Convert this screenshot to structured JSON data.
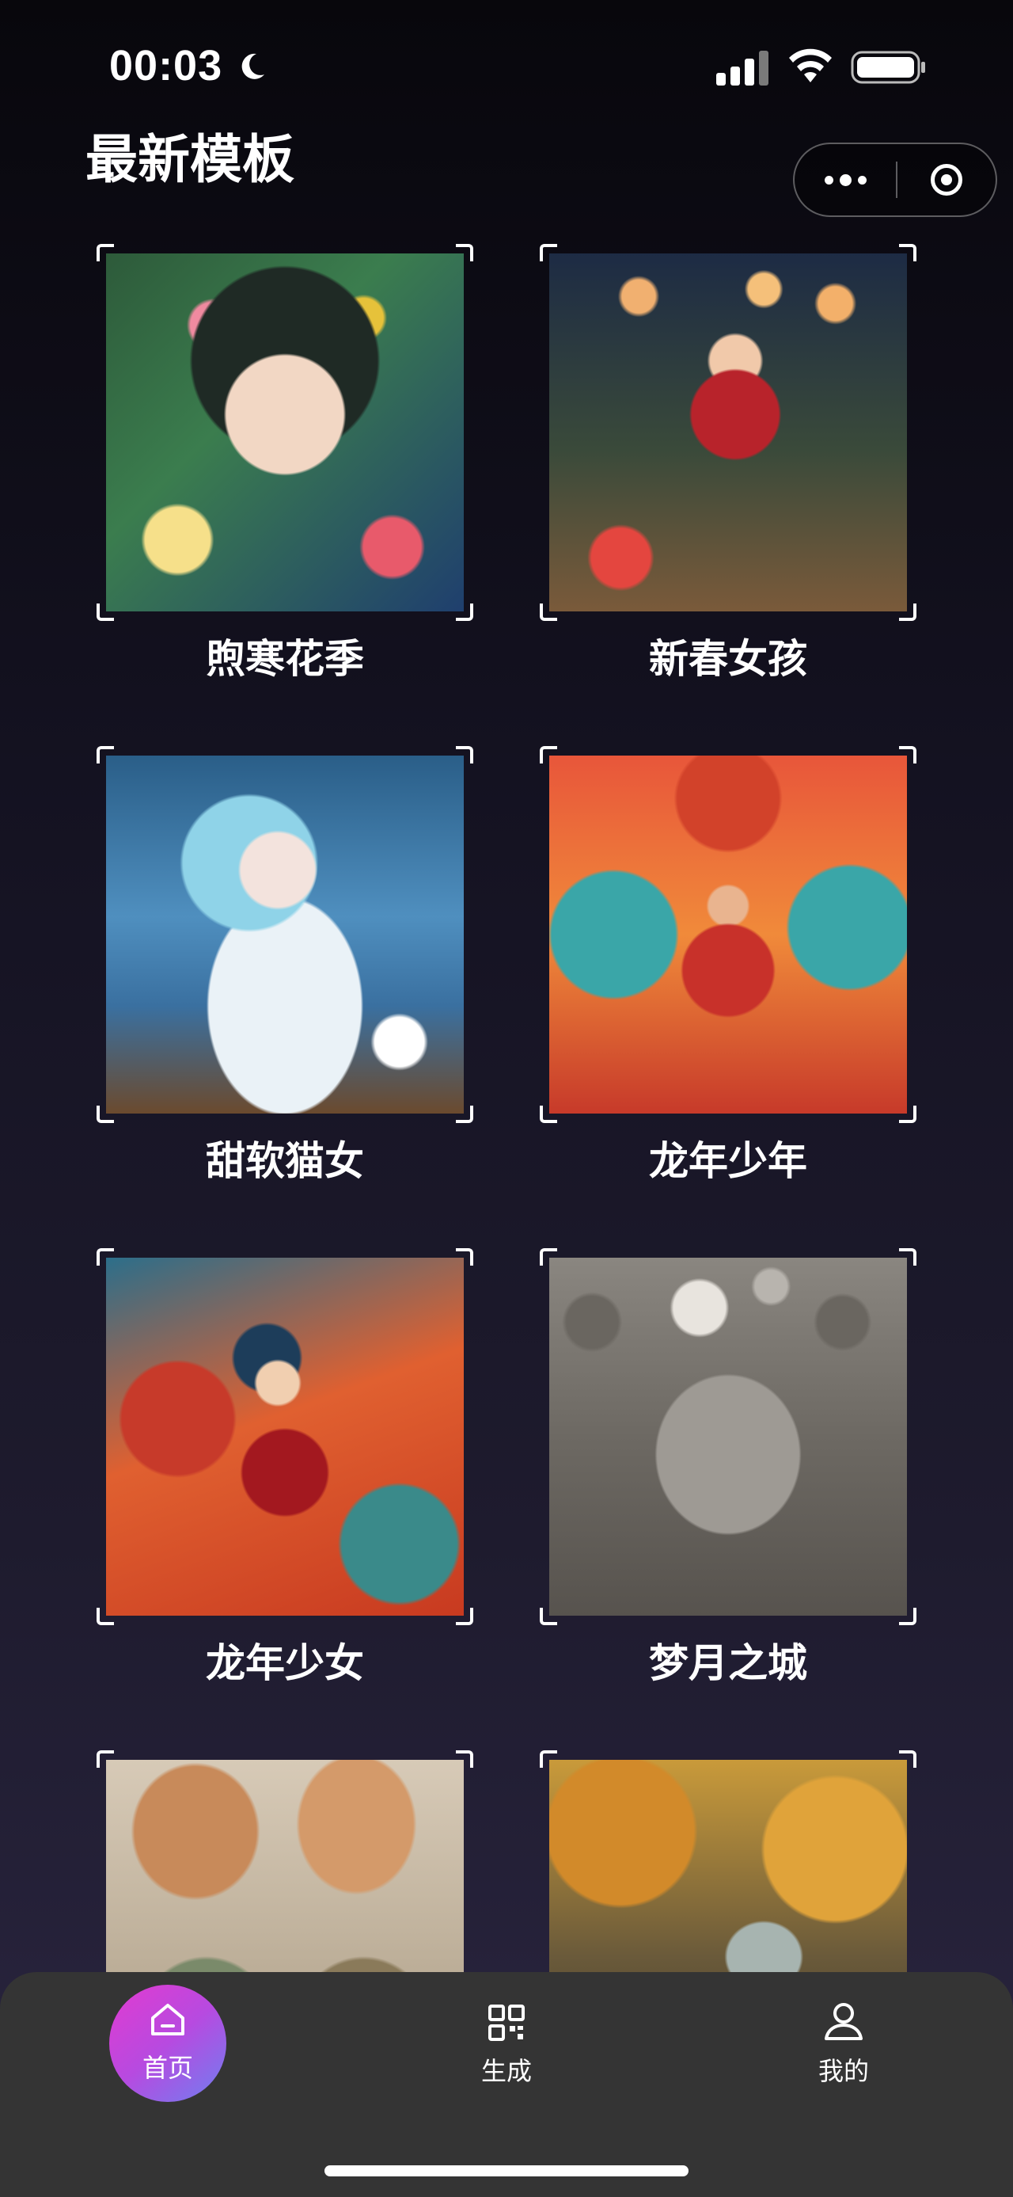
{
  "status_bar": {
    "time": "00:03",
    "icons": [
      "moon-icon",
      "signal-icon",
      "wifi-icon",
      "battery-icon"
    ]
  },
  "header": {
    "title": "最新模板",
    "capsule": {
      "more_icon": "more-dots-icon",
      "close_icon": "target-ring-icon"
    }
  },
  "templates": [
    {
      "title": "煦寒花季"
    },
    {
      "title": "新春女孩"
    },
    {
      "title": "甜软猫女"
    },
    {
      "title": "龙年少年"
    },
    {
      "title": "龙年少女"
    },
    {
      "title": "梦月之城"
    },
    {
      "title": ""
    },
    {
      "title": ""
    }
  ],
  "tab_bar": {
    "items": [
      {
        "label": "首页",
        "icon": "home-icon",
        "active": true
      },
      {
        "label": "生成",
        "icon": "qr-grid-icon",
        "active": false
      },
      {
        "label": "我的",
        "icon": "user-icon",
        "active": false
      }
    ],
    "active_gradient": [
      "#e23bd0",
      "#6f7ff0"
    ]
  },
  "colors": {
    "background_top": "#08070c",
    "background_bottom": "#2a2540",
    "tab_bar": "#343434"
  }
}
